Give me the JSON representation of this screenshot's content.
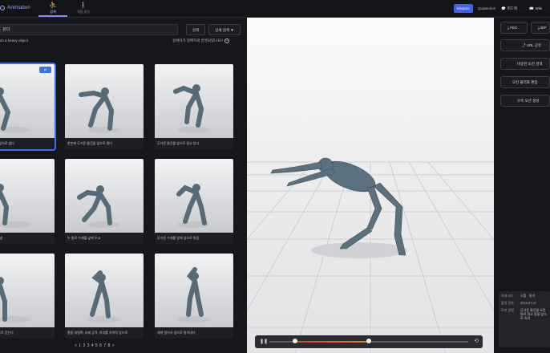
{
  "header": {
    "logo_text": "Animation",
    "tabs": [
      {
        "label": "검색",
        "icon": "person-run-icon",
        "active": true
      },
      {
        "label": "직접 생성",
        "icon": "person-walk-icon",
        "active": false
      }
    ],
    "lang": [
      "Mixamo",
      "Quaternion"
    ],
    "buttons": [
      {
        "label": "피드백",
        "icon": "chat-icon"
      },
      {
        "label": "Wiki",
        "icon": "book-icon"
      }
    ]
  },
  "search": {
    "query": "걷다",
    "search_button": "검색",
    "detail_button": "상세 검색 ▼",
    "subtitle": "sh a heavy object",
    "accuracy_text": "검색어가 정확하게 반영되었나요?"
  },
  "results": [
    {
      "caption": "한 손에 한쪽이 앞으로 앉다",
      "badge": "⇄",
      "selected": true
    },
    {
      "caption": "한손에 무거운 물건을 앞으로 밀다",
      "selected": false
    },
    {
      "caption": "무거운 물건을 앞으로 밀고 있다",
      "selected": false
    },
    {
      "caption": "걸음, 숙임, 밀어냄",
      "selected": false
    },
    {
      "caption": "두 팔로 수레를 앞에 두고",
      "selected": false
    },
    {
      "caption": "무거운 수레를 앞에 앞으로 밀음",
      "selected": false
    },
    {
      "caption": "무거운 짐을 앞으로 걷는다",
      "selected": false
    },
    {
      "caption": "팔을 내밀며, 자세 공격, 허리를 숙이며 앞으로",
      "selected": false
    },
    {
      "caption": "세게 밀어서 앞으로 밀어내다",
      "selected": false
    }
  ],
  "pagination": "< 1 2 3 4 5 6 7 8 >",
  "viewer": {
    "play_icon": "pause-icon",
    "loop_icon": "repeat-icon",
    "range_start": 0.13,
    "range_end": 0.5
  },
  "right_panel": {
    "buttons": [
      {
        "label": "FBX",
        "icon": "download-icon"
      },
      {
        "label": "BIP",
        "icon": "download-icon"
      },
      {
        "label": "URL 공유",
        "icon": "share-icon"
      },
      {
        "label": "비슷한 모션 검색"
      },
      {
        "label": "모션 불러와 편집"
      },
      {
        "label": "우측 모션 생성"
      }
    ],
    "meta": [
      {
        "key": "카테고리",
        "value": "소품 · 밀기"
      },
      {
        "key": "촬영 일자",
        "value": "2019.07.27"
      },
      {
        "key": "모션 설명",
        "value": "무거운 물건을 오른 팔로 밀고 몸을 앞으로 숙여"
      }
    ]
  }
}
